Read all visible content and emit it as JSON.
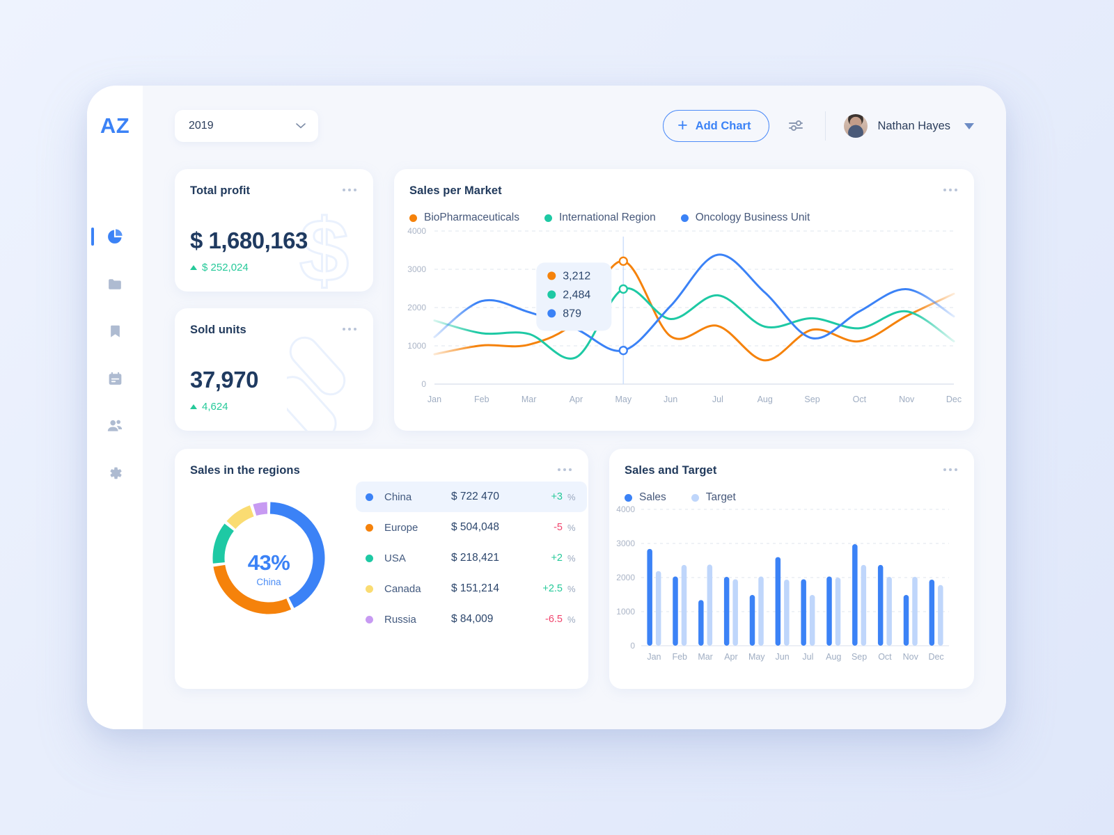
{
  "app": {
    "logo": "AZ"
  },
  "sidebar": {
    "items": [
      {
        "name": "analytics",
        "icon": "pie-chart-icon",
        "active": true
      },
      {
        "name": "files",
        "icon": "folder-icon",
        "active": false
      },
      {
        "name": "bookmarks",
        "icon": "bookmark-icon",
        "active": false
      },
      {
        "name": "calendar",
        "icon": "calendar-icon",
        "active": false
      },
      {
        "name": "team",
        "icon": "users-icon",
        "active": false
      },
      {
        "name": "settings",
        "icon": "gear-icon",
        "active": false
      }
    ]
  },
  "topbar": {
    "year_value": "2019",
    "add_chart_label": "Add Chart",
    "plus": "+",
    "filter_icon": "sliders-icon",
    "user_name": "Nathan Hayes"
  },
  "cards": {
    "total_profit": {
      "title": "Total profit",
      "value": "$ 1,680,163",
      "delta": "$ 252,024",
      "delta_direction": "up",
      "watermark": "dollar-sign-watermark"
    },
    "sold_units": {
      "title": "Sold units",
      "value": "37,970",
      "delta": "4,624",
      "delta_direction": "up",
      "watermark": "capsule-pills-watermark"
    },
    "sales_per_market": {
      "title": "Sales per Market"
    },
    "sales_regions": {
      "title": "Sales in the regions"
    },
    "sales_target": {
      "title": "Sales and Target"
    }
  },
  "colors": {
    "orange": "#f5820b",
    "teal": "#1ec9a4",
    "blue": "#3b82f6",
    "light_blue": "#bfd6fb",
    "yellow": "#fadc72",
    "purple": "#c79af2",
    "green_up": "#25c999",
    "red_down": "#f0436c",
    "text_dark": "#213a5c",
    "grid": "#dfe4ee"
  },
  "chart_data": [
    {
      "type": "line",
      "title": "Sales per Market",
      "xlabel": "",
      "ylabel": "",
      "ylim": [
        0,
        4000
      ],
      "yticks": [
        0,
        1000,
        2000,
        3000,
        4000
      ],
      "grid": true,
      "legend_position": "top-left",
      "x": [
        "Jan",
        "Feb",
        "Mar",
        "Apr",
        "May",
        "Jun",
        "Jul",
        "Aug",
        "Sep",
        "Oct",
        "Nov",
        "Dec"
      ],
      "series": [
        {
          "name": "BioPharmaceuticals",
          "color": "#f5820b",
          "values": [
            780,
            1010,
            1030,
            1640,
            3212,
            1250,
            1520,
            620,
            1420,
            1120,
            1780,
            2360
          ]
        },
        {
          "name": "International Region",
          "color": "#1ec9a4",
          "values": [
            1660,
            1330,
            1310,
            700,
            2484,
            1700,
            2320,
            1500,
            1720,
            1460,
            1900,
            1120
          ]
        },
        {
          "name": "Oncology Business Unit",
          "color": "#3b82f6",
          "values": [
            1230,
            2170,
            1880,
            1440,
            879,
            2040,
            3380,
            2390,
            1200,
            1900,
            2480,
            1770
          ]
        }
      ],
      "tooltip": {
        "x": "May",
        "rows": [
          {
            "color": "#f5820b",
            "value": "3,212"
          },
          {
            "color": "#1ec9a4",
            "value": "2,484"
          },
          {
            "color": "#3b82f6",
            "value": "879"
          }
        ]
      }
    },
    {
      "type": "pie",
      "title": "Sales in the regions",
      "center_value": "43%",
      "center_label": "China",
      "labels": [
        "China",
        "Europe",
        "USA",
        "Canada",
        "Russia"
      ],
      "values": [
        43,
        30,
        13,
        9,
        5
      ],
      "colors": [
        "#3b82f6",
        "#f5820b",
        "#1ec9a4",
        "#fadc72",
        "#c79af2"
      ],
      "rows": [
        {
          "label": "China",
          "color": "#3b82f6",
          "value": "$ 722 470",
          "change": "+3",
          "unit": "%",
          "direction": "up",
          "active": true
        },
        {
          "label": "Europe",
          "color": "#f5820b",
          "value": "$ 504,048",
          "change": "-5",
          "unit": "%",
          "direction": "down",
          "active": false
        },
        {
          "label": "USA",
          "color": "#1ec9a4",
          "value": "$ 218,421",
          "change": "+2",
          "unit": "%",
          "direction": "up",
          "active": false
        },
        {
          "label": "Canada",
          "color": "#fadc72",
          "value": "$ 151,214",
          "change": "+2.5",
          "unit": "%",
          "direction": "up",
          "active": false
        },
        {
          "label": "Russia",
          "color": "#c79af2",
          "value": "$ 84,009",
          "change": "-6.5",
          "unit": "%",
          "direction": "down",
          "active": false
        }
      ]
    },
    {
      "type": "bar",
      "title": "Sales and Target",
      "xlabel": "",
      "ylabel": "",
      "ylim": [
        0,
        4000
      ],
      "yticks": [
        0,
        1000,
        2000,
        3000,
        4000
      ],
      "grid": true,
      "legend_position": "top-left",
      "categories": [
        "Jan",
        "Feb",
        "Mar",
        "Apr",
        "May",
        "Jun",
        "Jul",
        "Aug",
        "Sep",
        "Oct",
        "Nov",
        "Dec"
      ],
      "series": [
        {
          "name": "Sales",
          "color": "#3b82f6",
          "values": [
            2840,
            2030,
            1340,
            2020,
            1490,
            2600,
            1950,
            2030,
            2980,
            2370,
            1490,
            1940
          ]
        },
        {
          "name": "Target",
          "color": "#bfd6fb",
          "values": [
            2190,
            2370,
            2380,
            1950,
            2030,
            1940,
            1490,
            2000,
            2370,
            2020,
            2020,
            1780
          ]
        }
      ]
    }
  ]
}
